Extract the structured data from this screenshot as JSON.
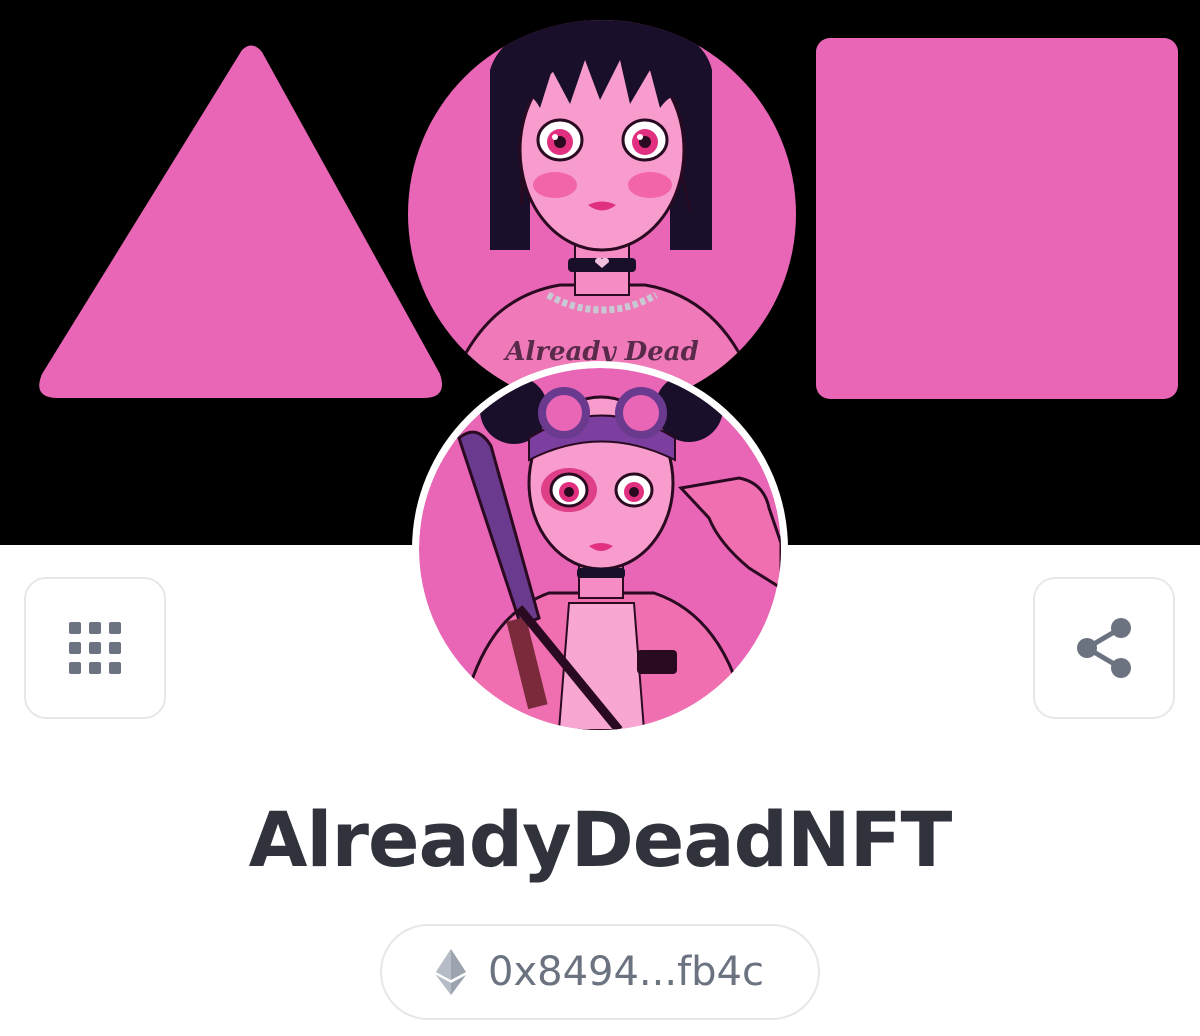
{
  "profile": {
    "name": "AlreadyDeadNFT",
    "wallet_address": "0x8494...fb4c",
    "chain_icon": "ethereum-icon"
  },
  "banner": {
    "shapes": [
      "triangle",
      "circle-portrait",
      "rounded-square"
    ],
    "tattoo_text": "Already Dead"
  },
  "buttons": {
    "apps_icon": "grid-icon",
    "share_icon": "share-icon"
  },
  "colors": {
    "brand_pink": "#e965b5",
    "banner_bg": "#000000",
    "name_text": "#30323c",
    "muted_text": "#6b7280",
    "border": "#e5e7eb"
  }
}
